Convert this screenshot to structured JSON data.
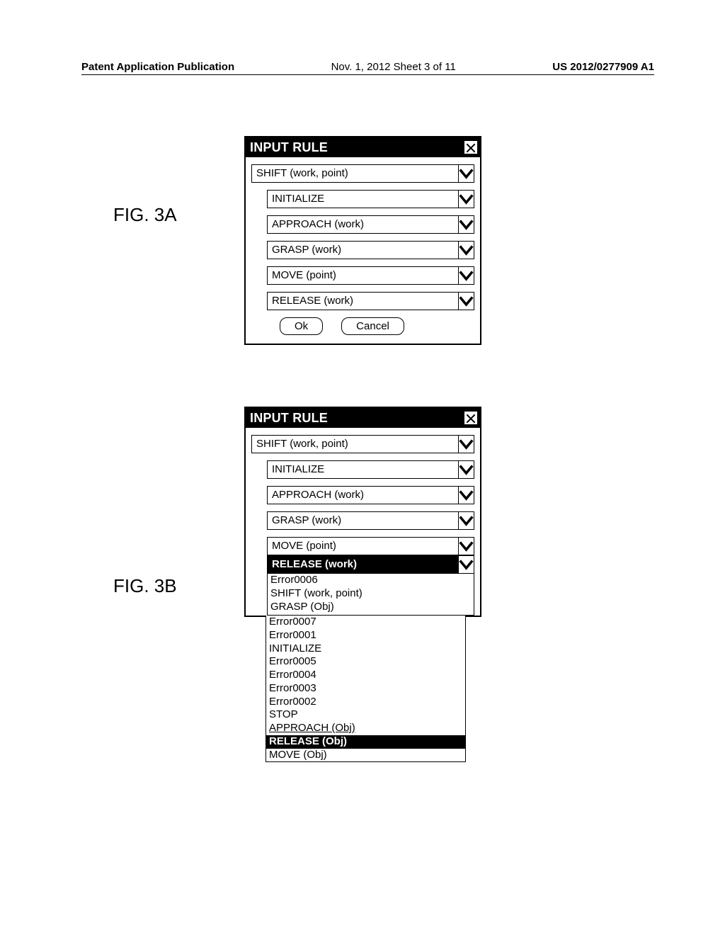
{
  "header": {
    "left": "Patent Application Publication",
    "center": "Nov. 1, 2012  Sheet 3 of 11",
    "right": "US 2012/0277909 A1"
  },
  "figA": {
    "label": "FIG. 3A",
    "dialog": {
      "title": "INPUT RULE",
      "main": "SHIFT (work, point)",
      "items": [
        "INITIALIZE",
        "APPROACH (work)",
        "GRASP (work)",
        "MOVE (point)",
        "RELEASE (work)"
      ],
      "ok": "Ok",
      "cancel": "Cancel"
    }
  },
  "figB": {
    "label": "FIG. 3B",
    "dialog": {
      "title": "INPUT RULE",
      "main": "SHIFT (work, point)",
      "items": [
        "INITIALIZE",
        "APPROACH (work)",
        "GRASP (work)",
        "MOVE (point)"
      ],
      "selected": "RELEASE (work)",
      "dropdown_inside": [
        "Error0006",
        "SHIFT (work, point)",
        "GRASP (Obj)"
      ],
      "dropdown_outside": [
        "Error0007",
        "Error0001",
        "INITIALIZE",
        "Error0005",
        "Error0004",
        "Error0003",
        "Error0002",
        "STOP",
        "APPROACH (Obj)"
      ],
      "dropdown_highlight": "RELEASE (Obj)",
      "dropdown_tail": "MOVE (Obj)"
    }
  }
}
